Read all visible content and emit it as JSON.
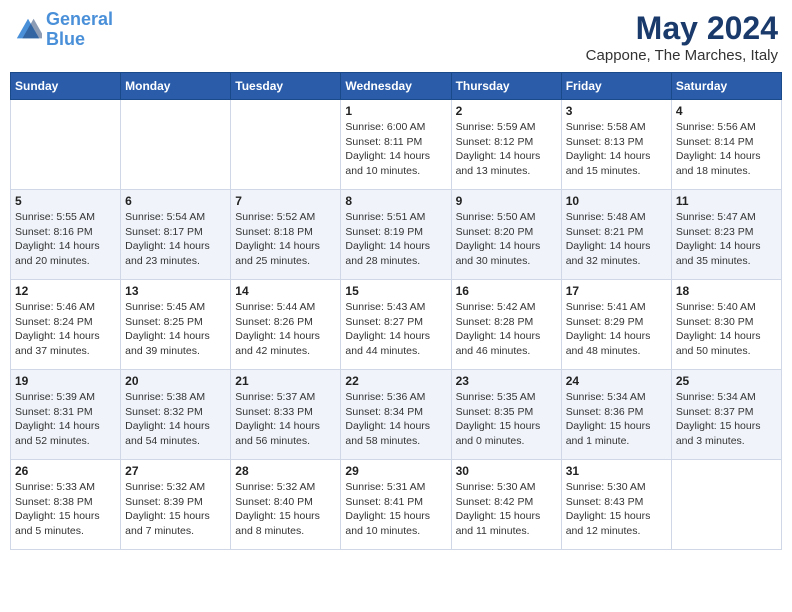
{
  "logo": {
    "text_general": "General",
    "text_blue": "Blue"
  },
  "header": {
    "month": "May 2024",
    "location": "Cappone, The Marches, Italy"
  },
  "weekdays": [
    "Sunday",
    "Monday",
    "Tuesday",
    "Wednesday",
    "Thursday",
    "Friday",
    "Saturday"
  ],
  "weeks": [
    [
      {
        "day": "",
        "info": ""
      },
      {
        "day": "",
        "info": ""
      },
      {
        "day": "",
        "info": ""
      },
      {
        "day": "1",
        "info": "Sunrise: 6:00 AM\nSunset: 8:11 PM\nDaylight: 14 hours\nand 10 minutes."
      },
      {
        "day": "2",
        "info": "Sunrise: 5:59 AM\nSunset: 8:12 PM\nDaylight: 14 hours\nand 13 minutes."
      },
      {
        "day": "3",
        "info": "Sunrise: 5:58 AM\nSunset: 8:13 PM\nDaylight: 14 hours\nand 15 minutes."
      },
      {
        "day": "4",
        "info": "Sunrise: 5:56 AM\nSunset: 8:14 PM\nDaylight: 14 hours\nand 18 minutes."
      }
    ],
    [
      {
        "day": "5",
        "info": "Sunrise: 5:55 AM\nSunset: 8:16 PM\nDaylight: 14 hours\nand 20 minutes."
      },
      {
        "day": "6",
        "info": "Sunrise: 5:54 AM\nSunset: 8:17 PM\nDaylight: 14 hours\nand 23 minutes."
      },
      {
        "day": "7",
        "info": "Sunrise: 5:52 AM\nSunset: 8:18 PM\nDaylight: 14 hours\nand 25 minutes."
      },
      {
        "day": "8",
        "info": "Sunrise: 5:51 AM\nSunset: 8:19 PM\nDaylight: 14 hours\nand 28 minutes."
      },
      {
        "day": "9",
        "info": "Sunrise: 5:50 AM\nSunset: 8:20 PM\nDaylight: 14 hours\nand 30 minutes."
      },
      {
        "day": "10",
        "info": "Sunrise: 5:48 AM\nSunset: 8:21 PM\nDaylight: 14 hours\nand 32 minutes."
      },
      {
        "day": "11",
        "info": "Sunrise: 5:47 AM\nSunset: 8:23 PM\nDaylight: 14 hours\nand 35 minutes."
      }
    ],
    [
      {
        "day": "12",
        "info": "Sunrise: 5:46 AM\nSunset: 8:24 PM\nDaylight: 14 hours\nand 37 minutes."
      },
      {
        "day": "13",
        "info": "Sunrise: 5:45 AM\nSunset: 8:25 PM\nDaylight: 14 hours\nand 39 minutes."
      },
      {
        "day": "14",
        "info": "Sunrise: 5:44 AM\nSunset: 8:26 PM\nDaylight: 14 hours\nand 42 minutes."
      },
      {
        "day": "15",
        "info": "Sunrise: 5:43 AM\nSunset: 8:27 PM\nDaylight: 14 hours\nand 44 minutes."
      },
      {
        "day": "16",
        "info": "Sunrise: 5:42 AM\nSunset: 8:28 PM\nDaylight: 14 hours\nand 46 minutes."
      },
      {
        "day": "17",
        "info": "Sunrise: 5:41 AM\nSunset: 8:29 PM\nDaylight: 14 hours\nand 48 minutes."
      },
      {
        "day": "18",
        "info": "Sunrise: 5:40 AM\nSunset: 8:30 PM\nDaylight: 14 hours\nand 50 minutes."
      }
    ],
    [
      {
        "day": "19",
        "info": "Sunrise: 5:39 AM\nSunset: 8:31 PM\nDaylight: 14 hours\nand 52 minutes."
      },
      {
        "day": "20",
        "info": "Sunrise: 5:38 AM\nSunset: 8:32 PM\nDaylight: 14 hours\nand 54 minutes."
      },
      {
        "day": "21",
        "info": "Sunrise: 5:37 AM\nSunset: 8:33 PM\nDaylight: 14 hours\nand 56 minutes."
      },
      {
        "day": "22",
        "info": "Sunrise: 5:36 AM\nSunset: 8:34 PM\nDaylight: 14 hours\nand 58 minutes."
      },
      {
        "day": "23",
        "info": "Sunrise: 5:35 AM\nSunset: 8:35 PM\nDaylight: 15 hours\nand 0 minutes."
      },
      {
        "day": "24",
        "info": "Sunrise: 5:34 AM\nSunset: 8:36 PM\nDaylight: 15 hours\nand 1 minute."
      },
      {
        "day": "25",
        "info": "Sunrise: 5:34 AM\nSunset: 8:37 PM\nDaylight: 15 hours\nand 3 minutes."
      }
    ],
    [
      {
        "day": "26",
        "info": "Sunrise: 5:33 AM\nSunset: 8:38 PM\nDaylight: 15 hours\nand 5 minutes."
      },
      {
        "day": "27",
        "info": "Sunrise: 5:32 AM\nSunset: 8:39 PM\nDaylight: 15 hours\nand 7 minutes."
      },
      {
        "day": "28",
        "info": "Sunrise: 5:32 AM\nSunset: 8:40 PM\nDaylight: 15 hours\nand 8 minutes."
      },
      {
        "day": "29",
        "info": "Sunrise: 5:31 AM\nSunset: 8:41 PM\nDaylight: 15 hours\nand 10 minutes."
      },
      {
        "day": "30",
        "info": "Sunrise: 5:30 AM\nSunset: 8:42 PM\nDaylight: 15 hours\nand 11 minutes."
      },
      {
        "day": "31",
        "info": "Sunrise: 5:30 AM\nSunset: 8:43 PM\nDaylight: 15 hours\nand 12 minutes."
      },
      {
        "day": "",
        "info": ""
      }
    ]
  ]
}
